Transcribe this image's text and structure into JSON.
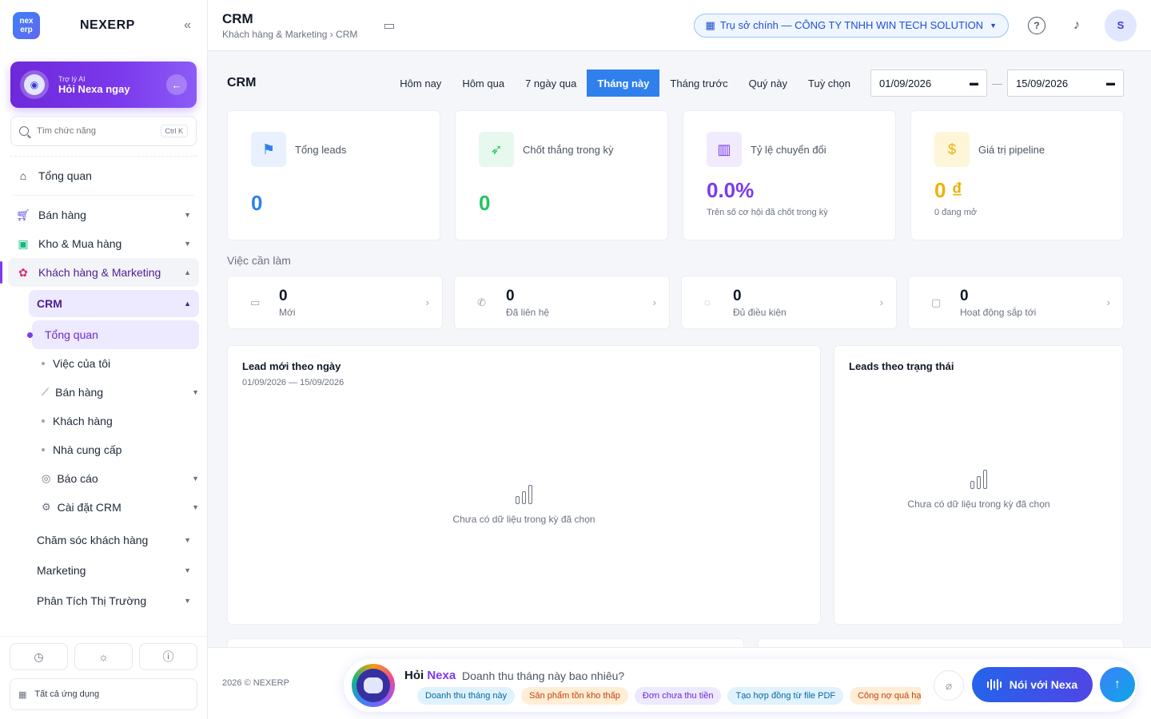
{
  "brand": {
    "logo_text": "nex erp",
    "name": "NEXERP",
    "collapse_icon": "«"
  },
  "ai_card": {
    "subtitle": "Trợ lý AI",
    "title": "Hỏi Nexa ngay"
  },
  "search": {
    "placeholder": "Tìm chức năng",
    "shortcut": "Ctrl K"
  },
  "sidebar": {
    "overview": "Tổng quan",
    "sales": "Bán hàng",
    "inventory": "Kho & Mua hàng",
    "crm_group": "Khách hàng & Marketing",
    "crm": "CRM",
    "crm_items": {
      "overview": "Tổng quan",
      "my_tasks": "Việc của tôi",
      "sales": "Bán hàng",
      "customers": "Khách hàng",
      "suppliers": "Nhà cung cấp",
      "reports": "Báo cáo",
      "settings": "Cài đặt CRM"
    },
    "customer_care": "Chăm sóc khách hàng",
    "marketing": "Marketing",
    "market_analysis": "Phân Tích Thị Trường",
    "all_apps": "Tất cả ứng dụng"
  },
  "header": {
    "title": "CRM",
    "breadcrumb": "Khách hàng & Marketing › CRM",
    "company": "Trụ sở chính — CÔNG TY TNHH WIN TECH SOLUTION",
    "user_initial": "S"
  },
  "toolbar": {
    "title": "CRM",
    "tabs": [
      "Hôm nay",
      "Hôm qua",
      "7 ngày qua",
      "Tháng này",
      "Tháng trước",
      "Quý này",
      "Tuỳ chọn"
    ],
    "active_tab": "Tháng này",
    "date_from": "01/09/2026",
    "date_to": "15/09/2026"
  },
  "kpis": [
    {
      "label": "Tổng leads",
      "value": "0",
      "color": "#2f80ed"
    },
    {
      "label": "Chốt thắng trong kỳ",
      "value": "0",
      "color": "#22c55e"
    },
    {
      "label": "Tỷ lệ chuyển đổi",
      "value": "0.0%",
      "note": "Trên số cơ hội đã chốt trong kỳ",
      "color": "#7c3aed"
    },
    {
      "label": "Giá trị pipeline",
      "value": "0 ₫",
      "note": "0 đang mở",
      "color": "#eab308"
    }
  ],
  "todo": {
    "title": "Việc cần làm",
    "items": [
      {
        "count": "0",
        "label": "Mới"
      },
      {
        "count": "0",
        "label": "Đã liên hệ"
      },
      {
        "count": "0",
        "label": "Đủ điều kiện"
      },
      {
        "count": "0",
        "label": "Hoạt động sắp tới"
      }
    ]
  },
  "panels": {
    "daily": {
      "title": "Lead mới theo ngày",
      "range": "01/09/2026 — 15/09/2026",
      "empty": "Chưa có dữ liệu trong kỳ đã chọn"
    },
    "status": {
      "title": "Leads theo trạng thái",
      "empty": "Chưa có dữ liệu trong kỳ đã chọn"
    }
  },
  "footer": {
    "copyright": "2026 © NEXERP",
    "ask_prefix": "Hỏi ",
    "ask_brand": "Nexa",
    "question": "Doanh thu tháng này bao nhiêu?",
    "chips": [
      {
        "label": "Doanh thu tháng này",
        "bg": "#e0f2fe",
        "fg": "#0369a1"
      },
      {
        "label": "Sản phẩm tồn kho thấp",
        "bg": "#ffedd5",
        "fg": "#c2410c"
      },
      {
        "label": "Đơn chưa thu tiền",
        "bg": "#ede9fe",
        "fg": "#6d28d9"
      },
      {
        "label": "Tạo hợp đồng từ file PDF",
        "bg": "#e0f2fe",
        "fg": "#0369a1"
      },
      {
        "label": "Công nợ quá hạn",
        "bg": "#ffedd5",
        "fg": "#c2410c"
      }
    ],
    "voice_label": "Nói với Nexa"
  }
}
